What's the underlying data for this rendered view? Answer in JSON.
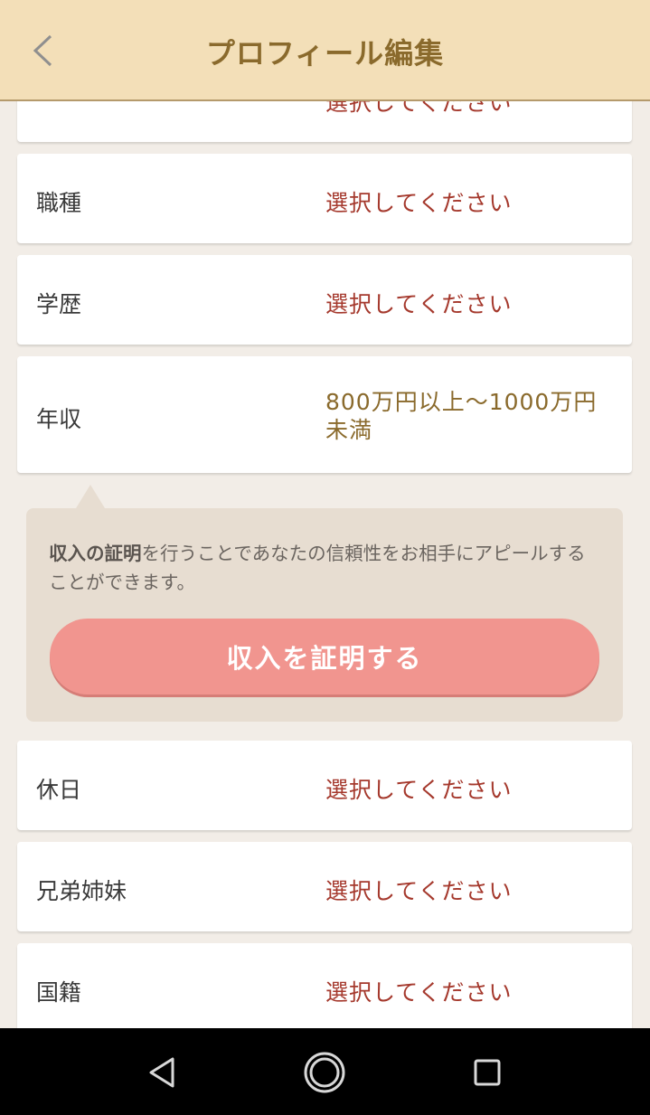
{
  "header": {
    "title": "プロフィール編集"
  },
  "top_partial_value": "選択してください",
  "rows": [
    {
      "label": "職種",
      "value": "選択してください"
    },
    {
      "label": "学歴",
      "value": "選択してください"
    },
    {
      "label": "年収",
      "value": "800万円以上〜1000万円未満"
    },
    {
      "label": "休日",
      "value": "選択してください"
    },
    {
      "label": "兄弟姉妹",
      "value": "選択してください"
    },
    {
      "label": "国籍",
      "value": "選択してください"
    }
  ],
  "income_info": {
    "bold_text": "収入の証明",
    "text": "を行うことであなたの信頼性をお相手にアピールすることができます。",
    "button_label": "収入を証明する"
  },
  "colors": {
    "header_bg": "#f3dfb8",
    "title": "#8a6a2c",
    "placeholder_value": "#a5392d",
    "selected_value": "#8a6a2c",
    "button": "#f1958f",
    "background": "#f2ede7"
  },
  "navbar": {
    "icons": [
      "back-triangle-icon",
      "home-circle-icon",
      "recents-square-icon"
    ]
  }
}
